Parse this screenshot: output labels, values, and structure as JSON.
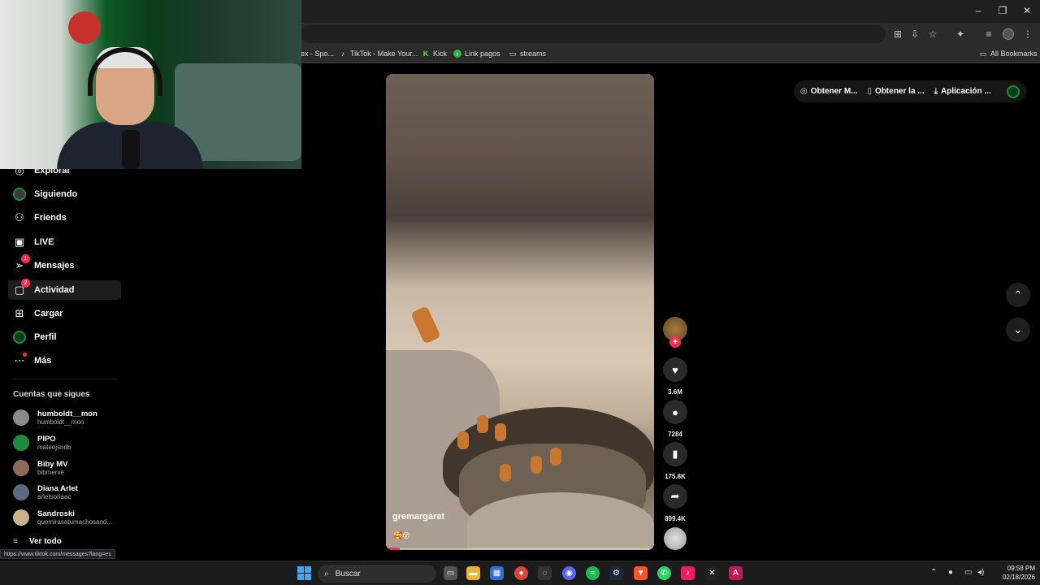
{
  "browser": {
    "bookmarks": [
      {
        "label": "ex - Spo...",
        "icon": "spotify-icon"
      },
      {
        "label": "TikTok - Make Your...",
        "icon": "tiktok-icon"
      },
      {
        "label": "Kick",
        "icon": "kick-icon"
      },
      {
        "label": "Link pagos",
        "icon": "link-icon"
      },
      {
        "label": "streams",
        "icon": "folder-icon"
      }
    ],
    "all_bookmarks": "All Bookmarks",
    "status_url": "https://www.tiktok.com/messages?lang=es"
  },
  "sidebar": {
    "items": [
      {
        "label": "Explorar",
        "icon": "compass-icon"
      },
      {
        "label": "Siguiendo",
        "icon": "avatar"
      },
      {
        "label": "Friends",
        "icon": "friends-icon"
      },
      {
        "label": "LIVE",
        "icon": "live-icon"
      },
      {
        "label": "Mensajes",
        "icon": "send-icon",
        "badge": "1"
      },
      {
        "label": "Actividad",
        "icon": "activity-icon",
        "badge": "2",
        "active": true
      },
      {
        "label": "Cargar",
        "icon": "upload-icon"
      },
      {
        "label": "Perfil",
        "icon": "avatar"
      },
      {
        "label": "Más",
        "icon": "more-icon"
      }
    ],
    "following_title": "Cuentas que sigues",
    "following": [
      {
        "name": "humboldt__mon",
        "handle": "humboldt__mon",
        "color": "#8a8a8a"
      },
      {
        "name": "PIPO",
        "handle": "mateojsndb",
        "color": "#1f8a3a"
      },
      {
        "name": "Biby MV",
        "handle": "bibmerve",
        "color": "#8c6a5a"
      },
      {
        "name": "Diana Arlet",
        "handle": "arletsoriaac",
        "color": "#5a6a80"
      },
      {
        "name": "Sandroski",
        "handle": "quemirasatumachosand...",
        "color": "#c9b58a"
      }
    ],
    "see_all": "Ver todo"
  },
  "video": {
    "author": "gremargaret",
    "emoji": "🥰😮",
    "progress": 0.05
  },
  "actions": {
    "likes": "3.6M",
    "comments": "7284",
    "saves": "175.8K",
    "shares": "899.4K"
  },
  "topbar": {
    "get_coins": "Obtener M...",
    "get_app": "Obtener la ...",
    "app": "Aplicación ..."
  },
  "taskbar": {
    "search_placeholder": "Buscar",
    "time": "09:58 PM",
    "date": "02/18/2026"
  },
  "colors": {
    "accent": "#fe2c55",
    "background": "#000000"
  }
}
